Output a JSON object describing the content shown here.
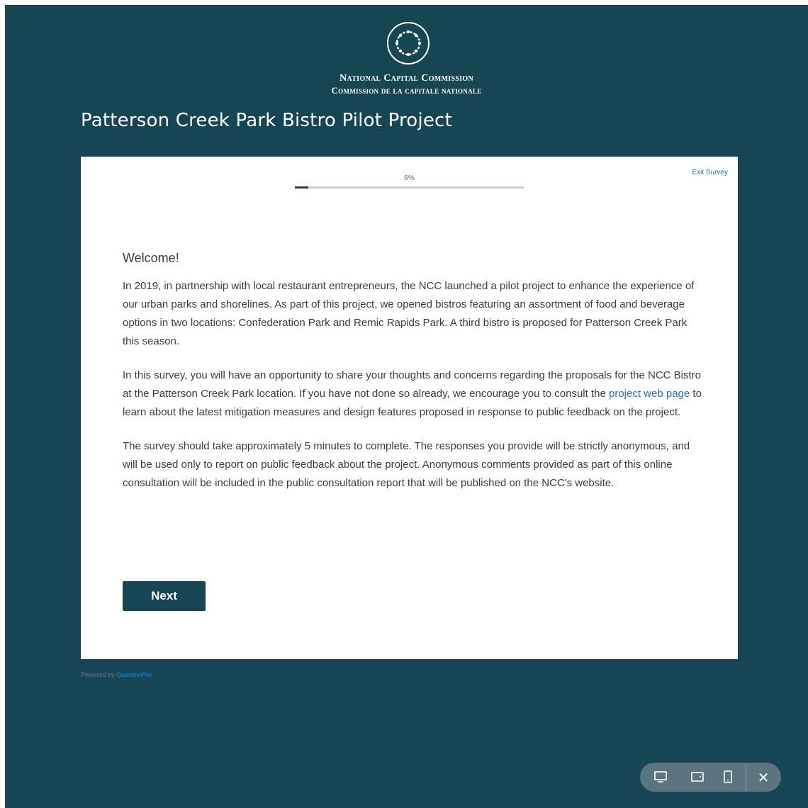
{
  "header": {
    "org_en": "National Capital Commission",
    "org_fr": "Commission de la capitale nationale",
    "logo_icon": "ncc-logo-icon"
  },
  "page_title": "Patterson Creek Park Bistro Pilot Project",
  "survey": {
    "progress_label": "6%",
    "progress_value": 0.06,
    "exit_label": "Exit Survey",
    "welcome_heading": "Welcome!",
    "p1": "In 2019, in partnership with local restaurant entrepreneurs, the NCC launched a pilot project to enhance the experience of our urban parks and shorelines. As part of this project, we opened bistros featuring an assortment of food and beverage options in two locations: Confederation Park and Remic Rapids Park. A third bistro is proposed for Patterson Creek Park this season.",
    "p2_before": "In this survey, you will have an opportunity to share your thoughts and concerns regarding the proposals for the NCC Bistro at the Patterson Creek Park location. If you have not done so already, we encourage you to consult the ",
    "p2_link": "project web page",
    "p2_after": " to learn about the latest mitigation measures and design features proposed in response to public feedback on the project.",
    "p3": "The survey should take approximately 5 minutes to complete. The responses you provide will be strictly anonymous, and will be used only to report on public feedback about the project. Anonymous comments provided as part of this online consultation will be included in the public consultation report that will be published on the NCC's website.",
    "next_label": "Next"
  },
  "footer": {
    "powered_by": "Powered by ",
    "powered_brand": "QuestionPro"
  },
  "preview_bar": {
    "icons": [
      "desktop-icon",
      "tablet-icon",
      "mobile-icon",
      "close-icon"
    ],
    "close_glyph": "✕"
  },
  "colors": {
    "background": "#164553",
    "accent_link": "#1a73c8",
    "button": "#164553"
  }
}
